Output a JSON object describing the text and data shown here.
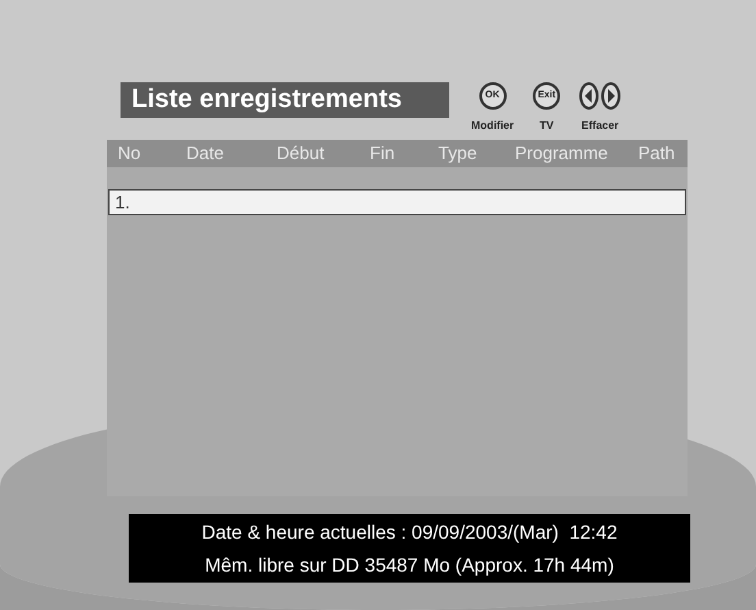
{
  "title": "Liste enregistrements",
  "hints": [
    {
      "kind": "ok",
      "key_label": "OK",
      "label": "Modifier"
    },
    {
      "kind": "exit",
      "key_label": "Exit",
      "label": "TV"
    },
    {
      "kind": "arrows",
      "label": "Effacer"
    }
  ],
  "table": {
    "columns": [
      "No",
      "Date",
      "Début",
      "Fin",
      "Type",
      "Programme",
      "Path"
    ],
    "rows": [
      {
        "no": "1.",
        "selected": true
      }
    ]
  },
  "status_bar": {
    "lines": [
      "Date & heure actuelles : 09/09/2003/(Mar)  12:42",
      "Mêm. libre sur DD 35487 Mo (Approx. 17h 44m)"
    ]
  }
}
